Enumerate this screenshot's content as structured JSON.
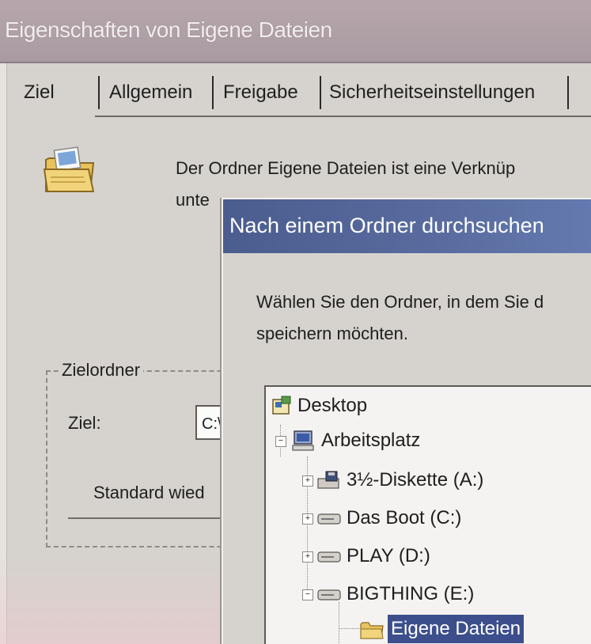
{
  "properties_dialog": {
    "title": "Eigenschaften von Eigene Dateien",
    "tabs": [
      "Ziel",
      "Allgemein",
      "Freigabe",
      "Sicherheitseinstellungen"
    ],
    "description_line1": "Der Ordner Eigene Dateien ist eine Verknüp",
    "description_line2": "unte",
    "group_title": "Zielordner",
    "target_label": "Ziel:",
    "target_value": "C:\\",
    "restore_button": "Standard wied"
  },
  "browse_dialog": {
    "title": "Nach einem Ordner durchsuchen",
    "instruction_line1": "Wählen Sie den Ordner, in dem Sie d",
    "instruction_line2": "speichern möchten.",
    "tree": [
      {
        "label": "Desktop",
        "icon": "desktop-icon"
      },
      {
        "label": "Arbeitsplatz",
        "icon": "computer-icon",
        "expanded": true
      },
      {
        "label": "3½-Diskette (A:)",
        "icon": "floppy-drive-icon"
      },
      {
        "label": "Das Boot (C:)",
        "icon": "hard-drive-icon"
      },
      {
        "label": "PLAY (D:)",
        "icon": "hard-drive-icon"
      },
      {
        "label": "BIGTHING (E:)",
        "icon": "hard-drive-icon",
        "expanded": true
      },
      {
        "label": "Eigene Dateien",
        "icon": "folder-icon",
        "selected": true
      }
    ]
  }
}
